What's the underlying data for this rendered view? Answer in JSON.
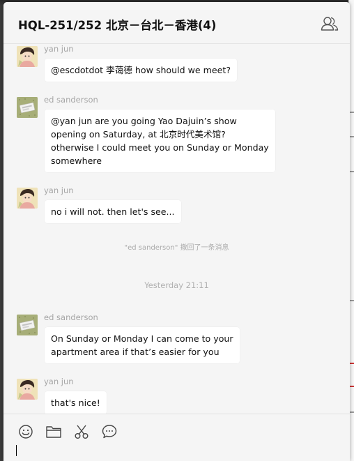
{
  "window": {
    "title": "HQL-251/252 北京－台北－香港(4)"
  },
  "header": {
    "members_icon": "group-icon"
  },
  "messages": [
    {
      "sender": "yan jun",
      "avatar": "yan-jun-avatar",
      "lines": [
        "@escdotdot 李蔼德 how should we meet?"
      ]
    },
    {
      "sender": "ed sanderson",
      "avatar": "ed-sanderson-avatar",
      "lines": [
        "@yan jun are you going Yao Dajuin’s show",
        "opening on Saturday, at 北京时代美术馆?",
        "otherwise I could meet you on Sunday or Monday",
        "somewhere"
      ]
    },
    {
      "sender": "yan jun",
      "avatar": "yan-jun-avatar",
      "lines": [
        "no i will not. then let's see..."
      ]
    },
    {
      "sender": "ed sanderson",
      "avatar": "ed-sanderson-avatar",
      "lines": [
        "On Sunday or Monday I can come to your",
        "apartment area if that’s easier for you"
      ]
    },
    {
      "sender": "yan jun",
      "avatar": "yan-jun-avatar",
      "lines": [
        "that's nice!"
      ]
    }
  ],
  "system_note": "\"ed sanderson\" 撤回了一条消息",
  "timestamp": "Yesterday 21:11",
  "composer": {
    "tools": [
      "emoji-icon",
      "folder-icon",
      "scissors-icon",
      "chat-bubble-icon"
    ]
  },
  "colors": {
    "window_bg": "#f5f5f5",
    "bubble_bg": "#ffffff",
    "meta_text": "#a6a6a6",
    "text": "#111111"
  }
}
